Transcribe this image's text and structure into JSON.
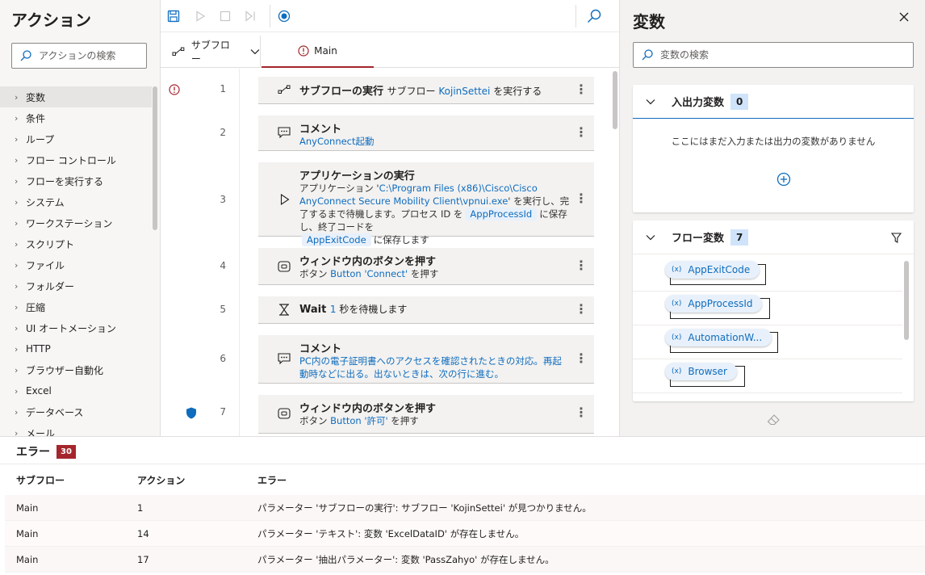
{
  "actions_pane": {
    "title": "アクション",
    "search_placeholder": "アクションの検索",
    "categories": [
      "変数",
      "条件",
      "ループ",
      "フロー コントロール",
      "フローを実行する",
      "システム",
      "ワークステーション",
      "スクリプト",
      "ファイル",
      "フォルダー",
      "圧縮",
      "UI オートメーション",
      "HTTP",
      "ブラウザー自動化",
      "Excel",
      "データベース",
      "メール"
    ]
  },
  "toolbar": {
    "icons": [
      "save-icon",
      "run-icon",
      "stop-icon",
      "step-icon",
      "record-icon",
      "search-icon"
    ]
  },
  "tabs": {
    "subflow_label": "サブフロー",
    "main_label": "Main"
  },
  "flow": {
    "steps": [
      {
        "num": "1",
        "title": "サブフローの実行",
        "desc_pre": "サブフロー ",
        "desc_link": "KojinSettei",
        "desc_post": " を実行する"
      },
      {
        "num": "2",
        "title": "コメント",
        "text": "AnyConnect起動"
      },
      {
        "num": "3",
        "title": "アプリケーションの実行",
        "p1": "アプリケーション '",
        "path": "C:\\Program Files (x86)\\Cisco\\Cisco AnyConnect Secure Mobility Client\\vpnui.exe",
        "p2": "' を実行し、完了するまで待機します。プロセス ID を",
        "chip1": "AppProcessId",
        "p3": "に保存し、終了コードを",
        "chip2": "AppExitCode",
        "p4": "に保存します"
      },
      {
        "num": "4",
        "title": "ウィンドウ内のボタンを押す",
        "pre": "ボタン ",
        "link": "Button 'Connect'",
        "post": " を押す"
      },
      {
        "num": "5",
        "title": "Wait",
        "num_link": "1",
        "post": " 秒を待機します"
      },
      {
        "num": "6",
        "title": "コメント",
        "text": "PC内の電子証明書へのアクセスを確認されたときの対応。再起動時などに出る。出ないときは、次の行に進む。"
      },
      {
        "num": "7",
        "title": "ウィンドウ内のボタンを押す",
        "pre": "ボタン ",
        "link": "Button '許可'",
        "post": " を押す"
      }
    ]
  },
  "vars_pane": {
    "title": "変数",
    "search_placeholder": "変数の検索",
    "io_section": {
      "title": "入出力変数",
      "count": "0",
      "empty_text": "ここにはまだ入力または出力の変数がありません"
    },
    "flow_section": {
      "title": "フロー変数",
      "count": "7",
      "items": [
        "AppExitCode",
        "AppProcessId",
        "AutomationW...",
        "Browser"
      ]
    },
    "var_marker": "(x)"
  },
  "errors": {
    "title": "エラー",
    "count": "30",
    "columns": {
      "subflow": "サブフロー",
      "action": "アクション",
      "error": "エラー"
    },
    "rows": [
      {
        "subflow": "Main",
        "action": "1",
        "error": "パラメーター 'サブフローの実行': サブフロー 'KojinSettei' が見つかりません。"
      },
      {
        "subflow": "Main",
        "action": "14",
        "error": "パラメーター 'テキスト': 変数 'ExcelDataID' が存在しません。"
      },
      {
        "subflow": "Main",
        "action": "17",
        "error": "パラメーター '抽出パラメーター': 変数 'PassZahyo' が存在しません。"
      }
    ]
  },
  "colors": {
    "accent": "#0f6cbd",
    "error": "#a4262c",
    "badge": "#cfe4fa"
  }
}
